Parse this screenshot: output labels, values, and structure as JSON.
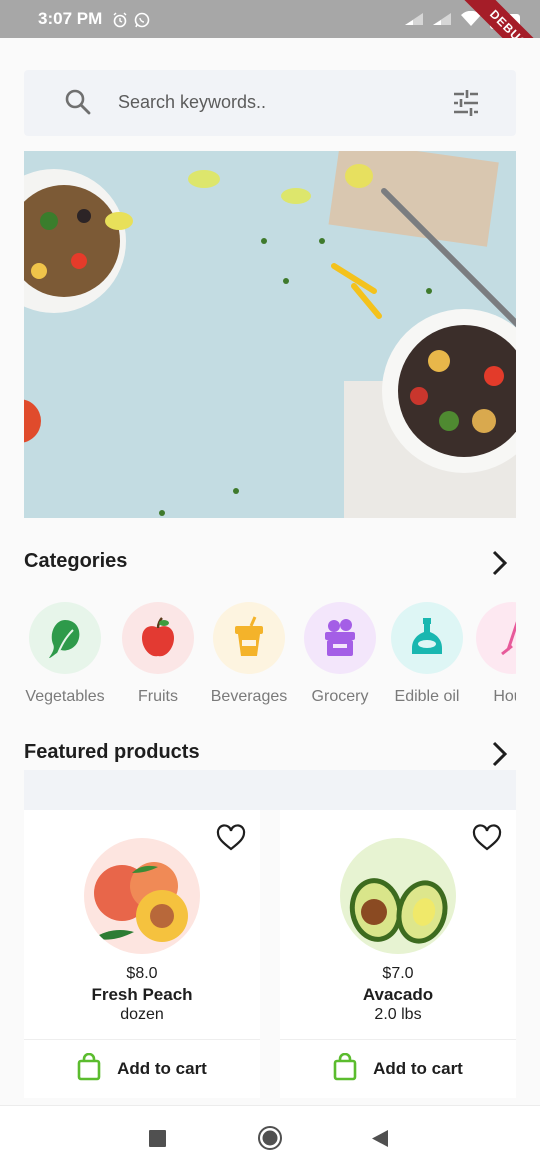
{
  "status_bar": {
    "time": "3:07 PM",
    "battery": "92",
    "debug_label": "DEBUG",
    "icons": [
      "alarm-icon",
      "whatsapp-icon",
      "signal-icon",
      "signal-icon",
      "wifi-icon",
      "battery-icon"
    ]
  },
  "search": {
    "placeholder": "Search keywords..",
    "icon": "search-icon",
    "filter_icon": "filter-sliders-icon"
  },
  "banner": {
    "image": "food-bowls-banner"
  },
  "categories": {
    "title": "Categories",
    "items": [
      {
        "label": "Vegetables",
        "icon": "leafy-greens-icon",
        "bg": "#e7f5ea"
      },
      {
        "label": "Fruits",
        "icon": "apple-icon",
        "bg": "#fbe6e6"
      },
      {
        "label": "Beverages",
        "icon": "drink-cup-icon",
        "bg": "#fdf4e0"
      },
      {
        "label": "Grocery",
        "icon": "grocery-box-icon",
        "bg": "#f3e6fb"
      },
      {
        "label": "Edible oil",
        "icon": "oil-bottle-icon",
        "bg": "#def6f5"
      },
      {
        "label": "Hous",
        "icon": "household-icon",
        "bg": "#fde8f1"
      }
    ]
  },
  "featured": {
    "title": "Featured products",
    "products": [
      {
        "price": "$8.0",
        "name": "Fresh Peach",
        "unit": "dozen",
        "cart_label": "Add to cart",
        "image": "peach-image",
        "image_bg": "#fde5e0"
      },
      {
        "price": "$7.0",
        "name": "Avacado",
        "unit": "2.0 lbs",
        "cart_label": "Add to cart",
        "image": "avocado-image",
        "image_bg": "#e7f3d2"
      }
    ]
  },
  "colors": {
    "accent_green": "#5bbc2e",
    "heading": "#1e1e1e",
    "muted": "#7a7a7a",
    "surface": "#f1f3f7"
  },
  "nav": {
    "items": [
      "recents-button",
      "home-button",
      "back-button"
    ]
  }
}
